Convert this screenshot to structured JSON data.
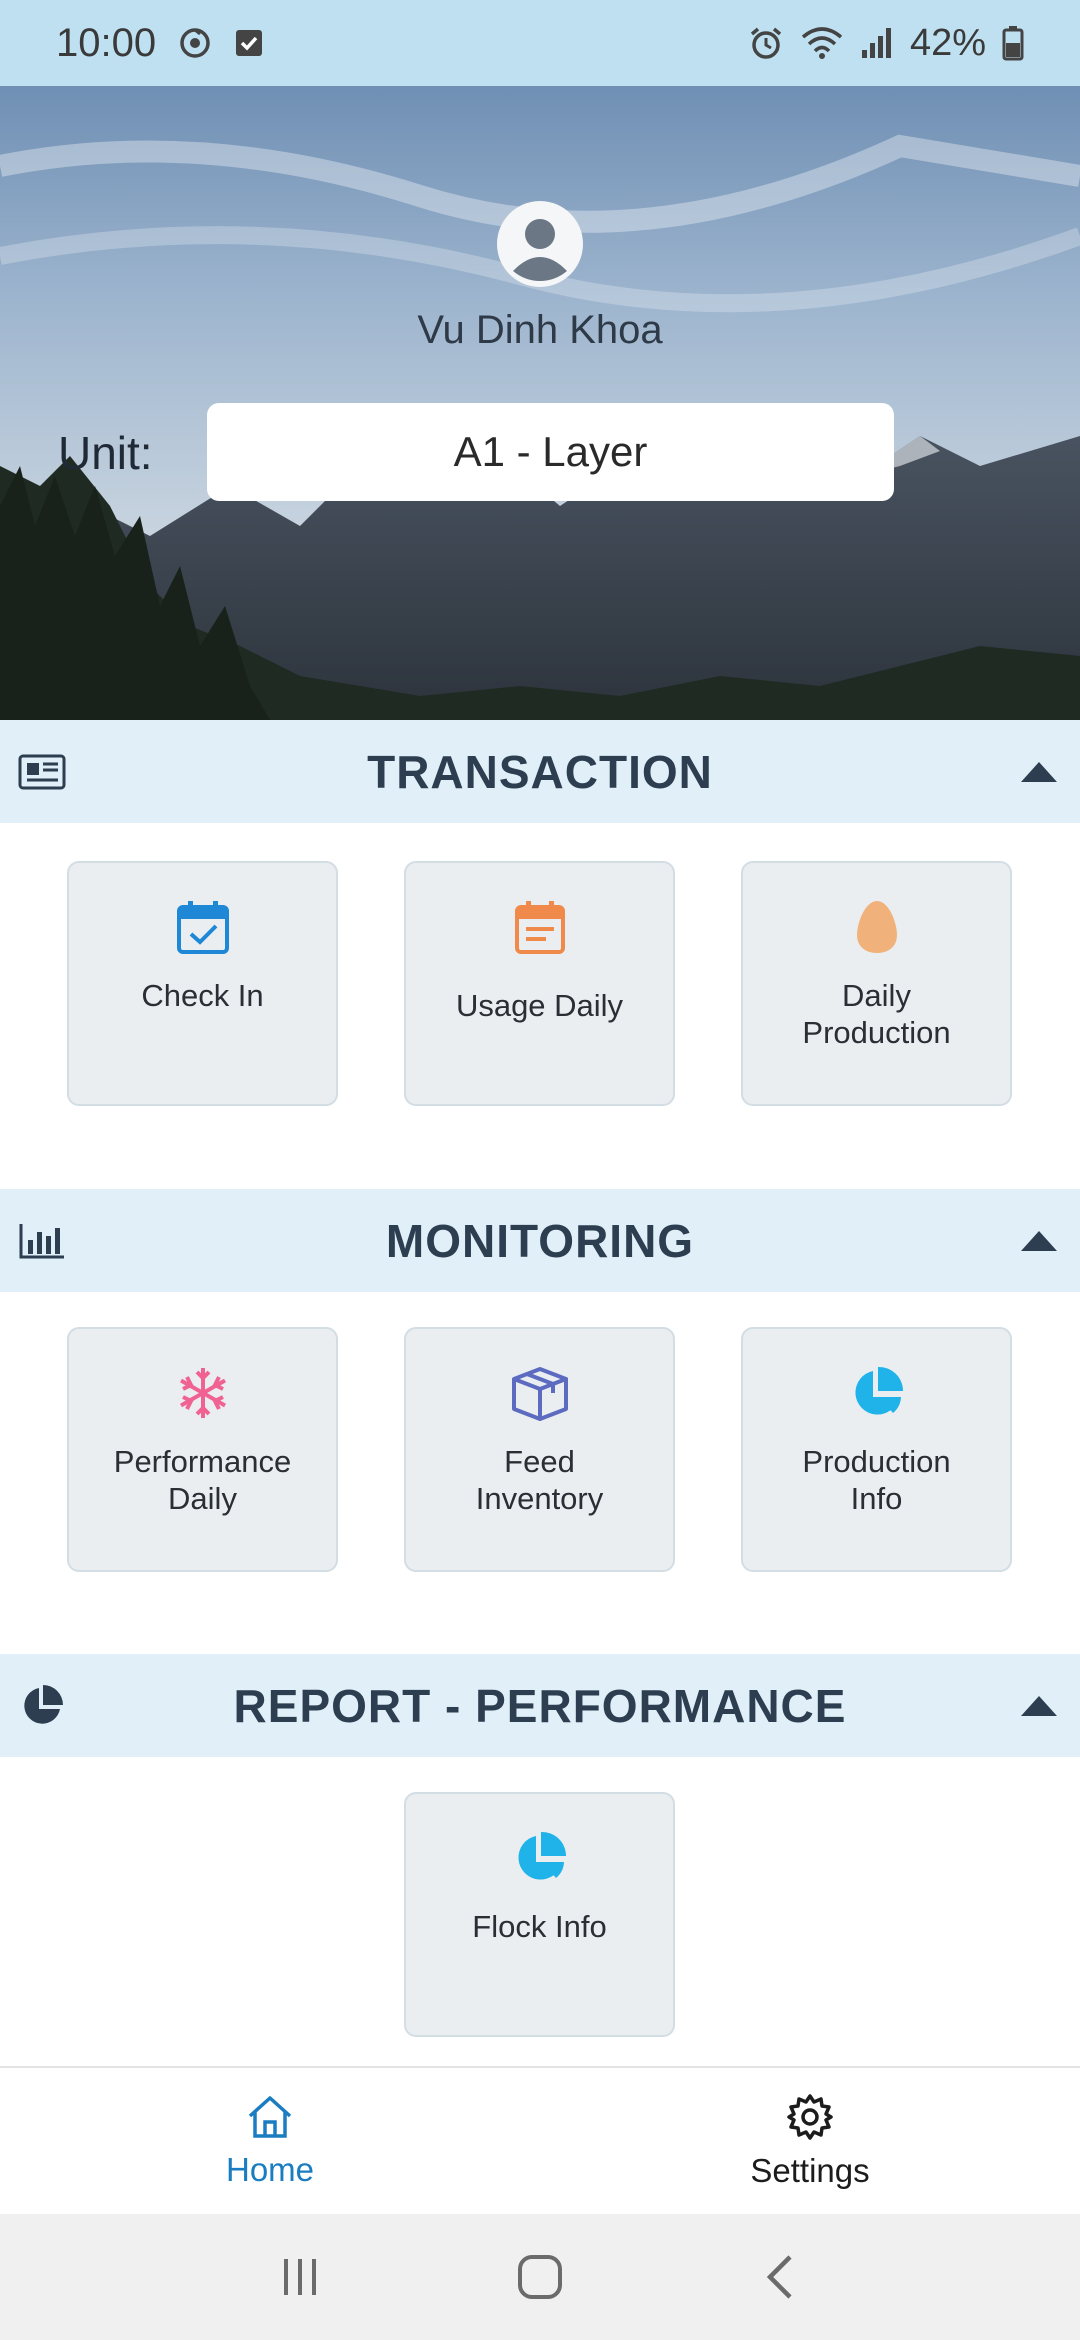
{
  "status_bar": {
    "time": "10:00",
    "battery": "42%"
  },
  "header": {
    "user_name": "Vu Dinh Khoa",
    "unit_label": "Unit:",
    "unit_value": "A1 - Layer"
  },
  "sections": {
    "transaction": {
      "title": "TRANSACTION",
      "tiles": [
        {
          "label": "Check In",
          "icon": "calendar-check-icon",
          "color": "#1e88d6"
        },
        {
          "label": "Usage Daily",
          "icon": "calendar-list-icon",
          "color": "#f08a4b"
        },
        {
          "label": "Daily\nProduction",
          "icon": "egg-icon",
          "color": "#f0b27a"
        }
      ]
    },
    "monitoring": {
      "title": "MONITORING",
      "tiles": [
        {
          "label": "Performance\nDaily",
          "icon": "snowflake-icon",
          "color": "#f06292"
        },
        {
          "label": "Feed\nInventory",
          "icon": "box-icon",
          "color": "#5c6bc0"
        },
        {
          "label": "Production\nInfo",
          "icon": "pie-chart-icon",
          "color": "#1fb3ea"
        }
      ]
    },
    "report": {
      "title": "REPORT - PERFORMANCE",
      "tiles": [
        {
          "label": "Flock Info",
          "icon": "pie-chart-icon",
          "color": "#1fb3ea"
        }
      ]
    }
  },
  "bottom_nav": {
    "home_label": "Home",
    "settings_label": "Settings",
    "active_color": "#1a7dc1"
  }
}
